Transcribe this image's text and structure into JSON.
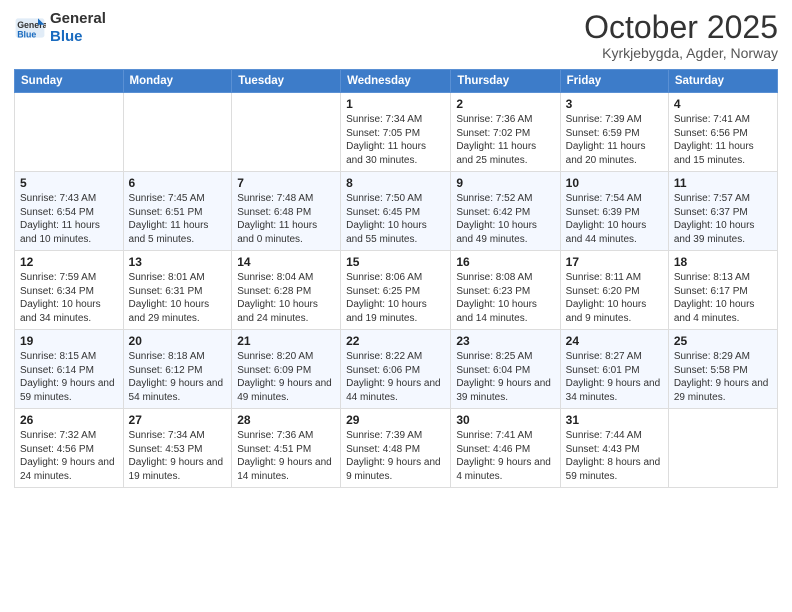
{
  "header": {
    "logo_general": "General",
    "logo_blue": "Blue",
    "month": "October 2025",
    "location": "Kyrkjebygda, Agder, Norway"
  },
  "weekdays": [
    "Sunday",
    "Monday",
    "Tuesday",
    "Wednesday",
    "Thursday",
    "Friday",
    "Saturday"
  ],
  "weeks": [
    [
      {
        "day": "",
        "info": ""
      },
      {
        "day": "",
        "info": ""
      },
      {
        "day": "",
        "info": ""
      },
      {
        "day": "1",
        "info": "Sunrise: 7:34 AM\nSunset: 7:05 PM\nDaylight: 11 hours and 30 minutes."
      },
      {
        "day": "2",
        "info": "Sunrise: 7:36 AM\nSunset: 7:02 PM\nDaylight: 11 hours and 25 minutes."
      },
      {
        "day": "3",
        "info": "Sunrise: 7:39 AM\nSunset: 6:59 PM\nDaylight: 11 hours and 20 minutes."
      },
      {
        "day": "4",
        "info": "Sunrise: 7:41 AM\nSunset: 6:56 PM\nDaylight: 11 hours and 15 minutes."
      }
    ],
    [
      {
        "day": "5",
        "info": "Sunrise: 7:43 AM\nSunset: 6:54 PM\nDaylight: 11 hours and 10 minutes."
      },
      {
        "day": "6",
        "info": "Sunrise: 7:45 AM\nSunset: 6:51 PM\nDaylight: 11 hours and 5 minutes."
      },
      {
        "day": "7",
        "info": "Sunrise: 7:48 AM\nSunset: 6:48 PM\nDaylight: 11 hours and 0 minutes."
      },
      {
        "day": "8",
        "info": "Sunrise: 7:50 AM\nSunset: 6:45 PM\nDaylight: 10 hours and 55 minutes."
      },
      {
        "day": "9",
        "info": "Sunrise: 7:52 AM\nSunset: 6:42 PM\nDaylight: 10 hours and 49 minutes."
      },
      {
        "day": "10",
        "info": "Sunrise: 7:54 AM\nSunset: 6:39 PM\nDaylight: 10 hours and 44 minutes."
      },
      {
        "day": "11",
        "info": "Sunrise: 7:57 AM\nSunset: 6:37 PM\nDaylight: 10 hours and 39 minutes."
      }
    ],
    [
      {
        "day": "12",
        "info": "Sunrise: 7:59 AM\nSunset: 6:34 PM\nDaylight: 10 hours and 34 minutes."
      },
      {
        "day": "13",
        "info": "Sunrise: 8:01 AM\nSunset: 6:31 PM\nDaylight: 10 hours and 29 minutes."
      },
      {
        "day": "14",
        "info": "Sunrise: 8:04 AM\nSunset: 6:28 PM\nDaylight: 10 hours and 24 minutes."
      },
      {
        "day": "15",
        "info": "Sunrise: 8:06 AM\nSunset: 6:25 PM\nDaylight: 10 hours and 19 minutes."
      },
      {
        "day": "16",
        "info": "Sunrise: 8:08 AM\nSunset: 6:23 PM\nDaylight: 10 hours and 14 minutes."
      },
      {
        "day": "17",
        "info": "Sunrise: 8:11 AM\nSunset: 6:20 PM\nDaylight: 10 hours and 9 minutes."
      },
      {
        "day": "18",
        "info": "Sunrise: 8:13 AM\nSunset: 6:17 PM\nDaylight: 10 hours and 4 minutes."
      }
    ],
    [
      {
        "day": "19",
        "info": "Sunrise: 8:15 AM\nSunset: 6:14 PM\nDaylight: 9 hours and 59 minutes."
      },
      {
        "day": "20",
        "info": "Sunrise: 8:18 AM\nSunset: 6:12 PM\nDaylight: 9 hours and 54 minutes."
      },
      {
        "day": "21",
        "info": "Sunrise: 8:20 AM\nSunset: 6:09 PM\nDaylight: 9 hours and 49 minutes."
      },
      {
        "day": "22",
        "info": "Sunrise: 8:22 AM\nSunset: 6:06 PM\nDaylight: 9 hours and 44 minutes."
      },
      {
        "day": "23",
        "info": "Sunrise: 8:25 AM\nSunset: 6:04 PM\nDaylight: 9 hours and 39 minutes."
      },
      {
        "day": "24",
        "info": "Sunrise: 8:27 AM\nSunset: 6:01 PM\nDaylight: 9 hours and 34 minutes."
      },
      {
        "day": "25",
        "info": "Sunrise: 8:29 AM\nSunset: 5:58 PM\nDaylight: 9 hours and 29 minutes."
      }
    ],
    [
      {
        "day": "26",
        "info": "Sunrise: 7:32 AM\nSunset: 4:56 PM\nDaylight: 9 hours and 24 minutes."
      },
      {
        "day": "27",
        "info": "Sunrise: 7:34 AM\nSunset: 4:53 PM\nDaylight: 9 hours and 19 minutes."
      },
      {
        "day": "28",
        "info": "Sunrise: 7:36 AM\nSunset: 4:51 PM\nDaylight: 9 hours and 14 minutes."
      },
      {
        "day": "29",
        "info": "Sunrise: 7:39 AM\nSunset: 4:48 PM\nDaylight: 9 hours and 9 minutes."
      },
      {
        "day": "30",
        "info": "Sunrise: 7:41 AM\nSunset: 4:46 PM\nDaylight: 9 hours and 4 minutes."
      },
      {
        "day": "31",
        "info": "Sunrise: 7:44 AM\nSunset: 4:43 PM\nDaylight: 8 hours and 59 minutes."
      },
      {
        "day": "",
        "info": ""
      }
    ]
  ]
}
